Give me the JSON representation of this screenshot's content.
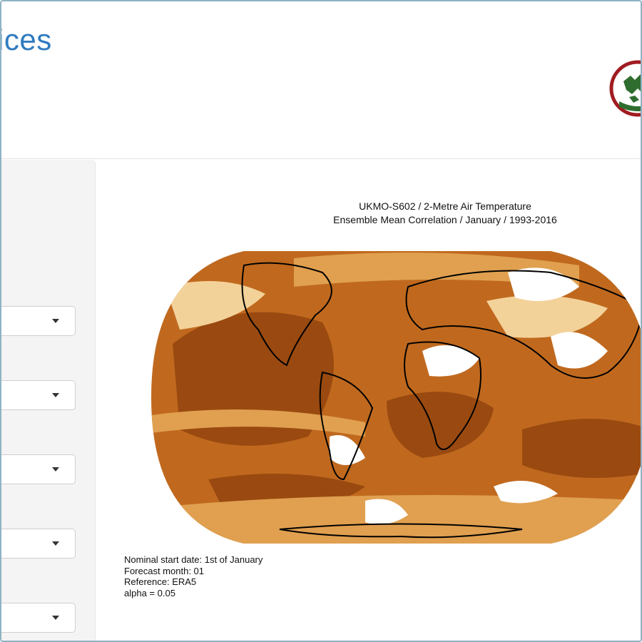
{
  "header": {
    "title": "ices",
    "logo_icon": "europe-globe-logo-icon"
  },
  "sidebar": {
    "selects": [
      {
        "value": ""
      },
      {
        "value": ""
      },
      {
        "value": ""
      },
      {
        "value": ""
      },
      {
        "value": ""
      }
    ]
  },
  "map": {
    "title_line1": "UKMO-S602 / 2-Metre Air Temperature",
    "title_line2": "Ensemble Mean Correlation / January / 1993-2016",
    "colors": {
      "dark": "#9a4a10",
      "mid": "#c0691e",
      "light": "#e0a050",
      "pale": "#f3d29a",
      "white": "#ffffff",
      "coast": "#000000"
    }
  },
  "notes": {
    "line1": "Nominal start date: 1st of January",
    "line2": "Forecast month: 01",
    "line3": "Reference: ERA5",
    "line4": "alpha = 0.05"
  }
}
